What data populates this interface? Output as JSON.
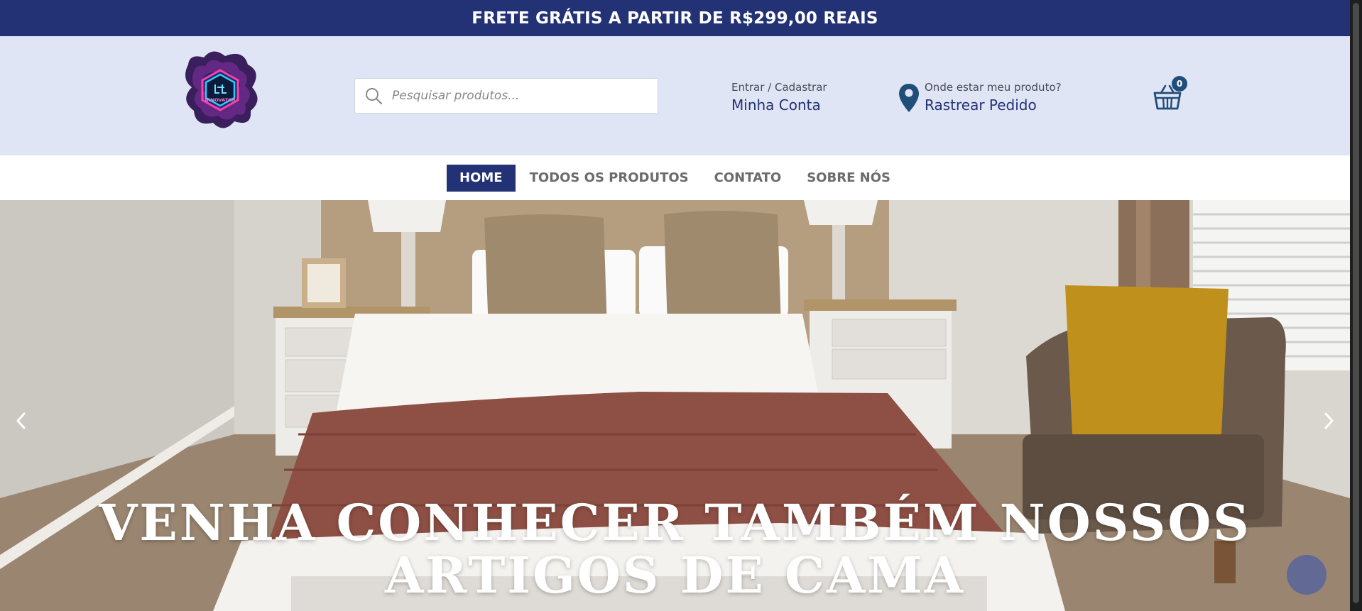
{
  "announcement": {
    "text": "FRETE GRÁTIS A PARTIR DE R$299,00 REAIS"
  },
  "logo": {
    "alt": "INNOVATCH"
  },
  "search": {
    "placeholder": "Pesquisar produtos..."
  },
  "account": {
    "small_label": "Entrar / Cadastrar",
    "big_label": "Minha Conta"
  },
  "tracking": {
    "small_label": "Onde estar meu produto?",
    "big_label": "Rastrear Pedido"
  },
  "cart": {
    "count": "0"
  },
  "nav": {
    "items": [
      {
        "label": "HOME",
        "active": true
      },
      {
        "label": "TODOS OS PRODUTOS"
      },
      {
        "label": "CONTATO"
      },
      {
        "label": "SOBRE NÓS"
      }
    ]
  },
  "hero": {
    "title_line1": "VENHA CONHECER TAMBÉM NOSSOS",
    "title_line2": "ARTIGOS DE CAMA"
  },
  "colors": {
    "brand_navy": "#233175",
    "header_bg": "#e0e5f5",
    "pin_blue": "#1f4e79"
  },
  "icons": {
    "search": "search-icon",
    "location": "location-pin-icon",
    "cart": "basket-icon",
    "prev": "chevron-left-icon",
    "next": "chevron-right-icon"
  }
}
